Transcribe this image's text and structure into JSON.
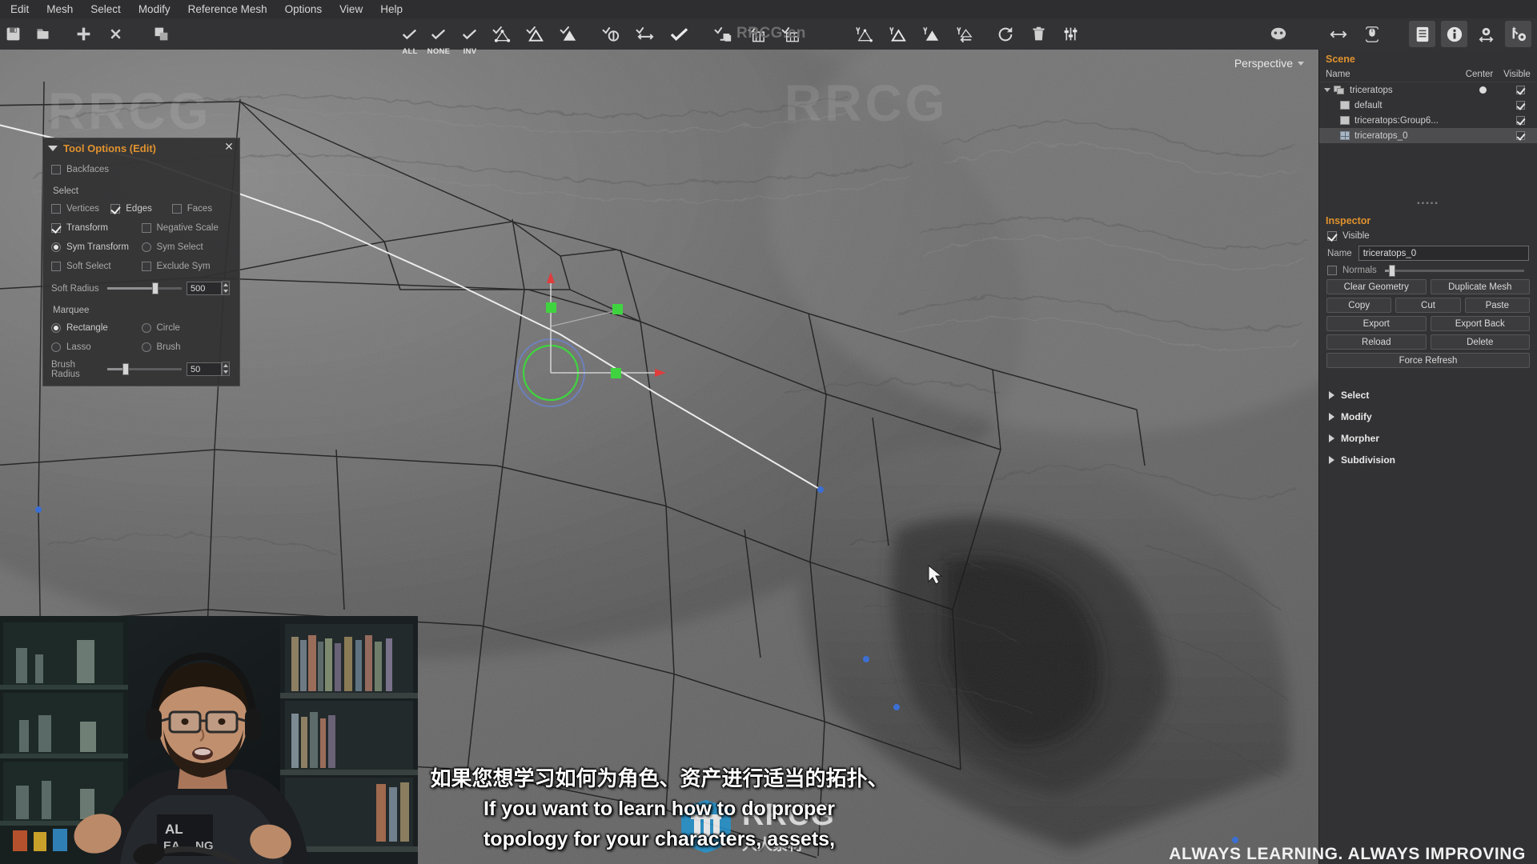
{
  "app": {
    "watermark_top": "RRCG.cn",
    "watermark_center": "RRCG",
    "watermark_center_sub": "人人素材",
    "brand_bottom": "ALWAYS LEARNING. ALWAYS IMPROVING"
  },
  "menubar": {
    "items": [
      {
        "label": "Edit"
      },
      {
        "label": "Mesh"
      },
      {
        "label": "Select"
      },
      {
        "label": "Modify"
      },
      {
        "label": "Reference Mesh"
      },
      {
        "label": "Options"
      },
      {
        "label": "View"
      },
      {
        "label": "Help"
      }
    ]
  },
  "toolbar": {
    "file_group": [
      {
        "name": "save-icon",
        "label": ""
      },
      {
        "name": "open-icon",
        "label": ""
      },
      {
        "name": "add-icon",
        "label": ""
      },
      {
        "name": "delete-icon",
        "label": ""
      },
      {
        "name": "duplicate-icon",
        "label": ""
      }
    ],
    "select_group": [
      {
        "name": "select-all-icon",
        "label": "ALL"
      },
      {
        "name": "select-none-icon",
        "label": "NONE"
      },
      {
        "name": "select-invert-icon",
        "label": "INV"
      },
      {
        "name": "select-vertices-icon",
        "label": ""
      },
      {
        "name": "select-edges-icon",
        "label": ""
      },
      {
        "name": "select-faces-icon",
        "label": ""
      }
    ],
    "modify_group": [
      {
        "name": "convert-icon",
        "label": ""
      },
      {
        "name": "grow-shrink-icon",
        "label": ""
      },
      {
        "name": "confirm-icon",
        "label": ""
      },
      {
        "name": "extrude-icon",
        "label": ""
      },
      {
        "name": "bridge-icon",
        "label": ""
      },
      {
        "name": "grid-fill-icon",
        "label": ""
      }
    ],
    "tools_group": [
      {
        "name": "tweak-vertices-icon",
        "label": ""
      },
      {
        "name": "tweak-edges-icon",
        "label": ""
      },
      {
        "name": "tweak-faces-icon",
        "label": ""
      },
      {
        "name": "relax-icon",
        "label": ""
      }
    ],
    "action_group": [
      {
        "name": "refresh-icon",
        "label": ""
      },
      {
        "name": "trash-icon",
        "label": ""
      },
      {
        "name": "settings-sliders-icon",
        "label": ""
      }
    ],
    "right_group": [
      {
        "name": "mask-icon",
        "label": ""
      },
      {
        "name": "resize-arrows-icon",
        "label": ""
      },
      {
        "name": "mouse-icon",
        "label": ""
      },
      {
        "name": "clipboard-icon",
        "label": ""
      },
      {
        "name": "info-icon",
        "label": ""
      },
      {
        "name": "gear-move-icon",
        "label": ""
      },
      {
        "name": "wrench-gear-icon",
        "label": ""
      }
    ]
  },
  "viewport": {
    "perspective_label": "Perspective"
  },
  "tool_options": {
    "title": "Tool Options (Edit)",
    "close_label": "✕",
    "backfaces": {
      "label": "Backfaces",
      "checked": false
    },
    "select_section_label": "Select",
    "select_modes": [
      {
        "label": "Vertices",
        "checked": false
      },
      {
        "label": "Edges",
        "checked": true
      },
      {
        "label": "Faces",
        "checked": false
      }
    ],
    "transform": {
      "label": "Transform",
      "checked": true
    },
    "negative_scale": {
      "label": "Negative Scale",
      "checked": false
    },
    "sym_transform": {
      "label": "Sym Transform",
      "checked": true
    },
    "sym_select": {
      "label": "Sym Select",
      "checked": false
    },
    "soft_select": {
      "label": "Soft Select",
      "checked": false
    },
    "exclude_sym": {
      "label": "Exclude Sym",
      "checked": false
    },
    "soft_radius": {
      "label": "Soft Radius",
      "value": "500",
      "percent": 62
    },
    "marquee_section_label": "Marquee",
    "marquee_modes": [
      {
        "label": "Rectangle",
        "checked": true
      },
      {
        "label": "Circle",
        "checked": false
      },
      {
        "label": "Lasso",
        "checked": false
      },
      {
        "label": "Brush",
        "checked": false
      }
    ],
    "brush_radius": {
      "label": "Brush Radius",
      "value": "50",
      "percent": 22
    }
  },
  "scene": {
    "title": "Scene",
    "columns": {
      "name": "Name",
      "center": "Center",
      "visible": "Visible"
    },
    "rows": [
      {
        "label": "triceratops",
        "icon": "mesh-group-icon",
        "depth": 0,
        "expanded": true,
        "center": true,
        "visible": true,
        "selected": false
      },
      {
        "label": "default",
        "icon": "layer-icon",
        "depth": 1,
        "expanded": false,
        "center": false,
        "visible": true,
        "selected": false
      },
      {
        "label": "triceratops:Group6...",
        "icon": "layer-icon",
        "depth": 1,
        "expanded": false,
        "center": false,
        "visible": true,
        "selected": false
      },
      {
        "label": "triceratops_0",
        "icon": "grid-mesh-icon",
        "depth": 1,
        "expanded": false,
        "center": false,
        "visible": true,
        "selected": true
      }
    ]
  },
  "inspector": {
    "title": "Inspector",
    "visible": {
      "label": "Visible",
      "checked": true
    },
    "name_label": "Name",
    "name_value": "triceratops_0",
    "normals": {
      "label": "Normals",
      "checked": false,
      "percent": 5
    },
    "buttons": [
      [
        "Clear Geometry",
        "Duplicate Mesh"
      ],
      [
        "Copy",
        "Cut",
        "Paste"
      ],
      [
        "Export",
        "Export Back"
      ],
      [
        "Reload",
        "Delete"
      ],
      [
        "Force Refresh"
      ]
    ],
    "sections": [
      {
        "label": "Select"
      },
      {
        "label": "Modify"
      },
      {
        "label": "Morpher"
      },
      {
        "label": "Subdivision"
      }
    ]
  },
  "subtitles": {
    "chinese": "如果您想学习如何为角色、资产进行适当的拓扑、",
    "english_line1": "If you want to learn how to do proper",
    "english_line2": "topology for your characters, assets,"
  },
  "colors": {
    "accent": "#e0922e",
    "panel_bg": "#323234",
    "toolbar_bg": "#333336",
    "menubar_bg": "#2e2e30",
    "viewport_bg": "#6b6b6b",
    "gizmo_red": "#e03c3c",
    "gizmo_green": "#3fd43f",
    "selection_blue": "#4a7de0"
  }
}
